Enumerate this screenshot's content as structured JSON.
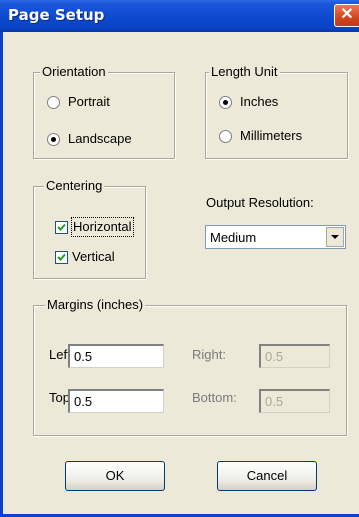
{
  "window": {
    "title": "Page Setup",
    "close_glyph": "✕"
  },
  "orientation": {
    "legend": "Orientation",
    "options": [
      {
        "label": "Portrait",
        "selected": false
      },
      {
        "label": "Landscape",
        "selected": true
      }
    ]
  },
  "length_unit": {
    "legend": "Length Unit",
    "options": [
      {
        "label": "Inches",
        "selected": true
      },
      {
        "label": "Millimeters",
        "selected": false
      }
    ]
  },
  "centering": {
    "legend": "Centering",
    "options": [
      {
        "label": "Horizontal",
        "checked": true
      },
      {
        "label": "Vertical",
        "checked": true
      }
    ]
  },
  "output_resolution": {
    "label": "Output Resolution:",
    "value": "Medium"
  },
  "margins": {
    "legend": "Margins (inches)",
    "left": {
      "label": "Left:",
      "value": "0.5",
      "enabled": true
    },
    "right": {
      "label": "Right:",
      "value": "0.5",
      "enabled": false
    },
    "top": {
      "label": "Top:",
      "value": "0.5",
      "enabled": true
    },
    "bottom": {
      "label": "Bottom:",
      "value": "0.5",
      "enabled": false
    }
  },
  "buttons": {
    "ok": "OK",
    "cancel": "Cancel"
  },
  "icons": {
    "close": "close-icon",
    "dropdown": "chevron-down-icon",
    "check": "check-icon"
  }
}
